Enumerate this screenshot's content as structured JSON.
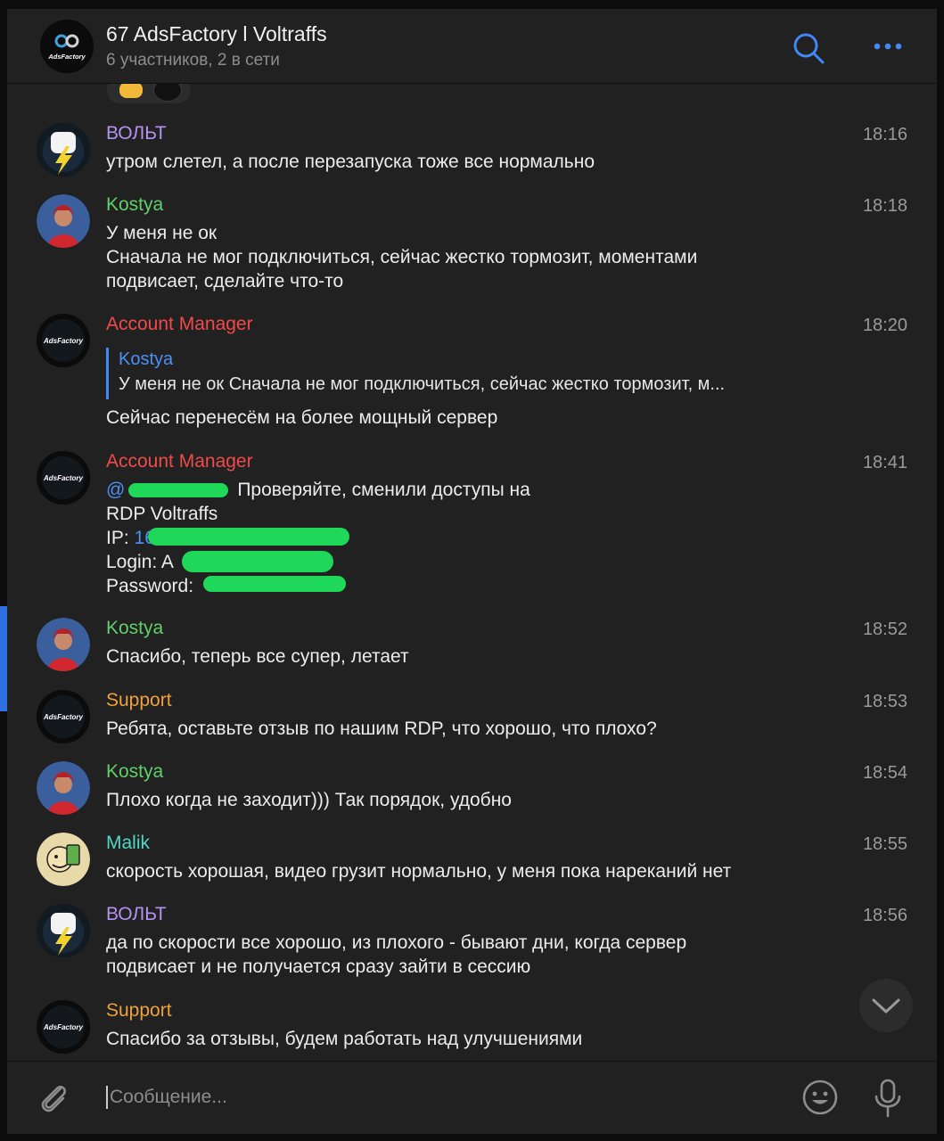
{
  "header": {
    "title": "67 AdsFactory l Voltraffs",
    "subtitle": "6 участников, 2 в сети",
    "avatar_logo_text": "AdsFactory"
  },
  "messages": [
    {
      "sender": "ВОЛЬТ",
      "sender_color": "#b392f0",
      "time": "18:16",
      "avatar": "volt",
      "text": "утром слетел, а после перезапуска тоже все нормально"
    },
    {
      "sender": "Kostya",
      "sender_color": "#5fd06a",
      "time": "18:18",
      "avatar": "kostya",
      "text": "У меня не ок\nСначала не мог подключиться, сейчас жестко тормозит, моментами\nподвисает, сделайте что-то"
    },
    {
      "sender": "Account Manager",
      "sender_color": "#f04a4a",
      "time": "18:20",
      "avatar": "adsfactory",
      "reply_name": "Kostya",
      "reply_text": "У меня не ок Сначала не мог подключиться, сейчас жестко тормозит, м...",
      "text": "Сейчас перенесём на более мощный сервер"
    },
    {
      "sender": "Account Manager",
      "sender_color": "#f04a4a",
      "time": "18:41",
      "avatar": "adsfactory",
      "mention": "@",
      "line1": "Проверяйте, сменили доступы на",
      "line2": "RDP Voltraffs",
      "ip_label": "IP: ",
      "ip_value": "16",
      "login_label": "Login: A",
      "password_label": "Password: "
    },
    {
      "sender": "Kostya",
      "sender_color": "#5fd06a",
      "time": "18:52",
      "avatar": "kostya",
      "text": "Спасибо, теперь все супер, летает"
    },
    {
      "sender": "Support",
      "sender_color": "#f0a13a",
      "time": "18:53",
      "avatar": "adsfactory",
      "text": "Ребята, оставьте отзыв по нашим RDP, что хорошо, что плохо?"
    },
    {
      "sender": "Kostya",
      "sender_color": "#5fd06a",
      "time": "18:54",
      "avatar": "kostya",
      "text": "Плохо когда не заходит))) Так порядок, удобно"
    },
    {
      "sender": "Malik",
      "sender_color": "#4fd8c4",
      "time": "18:55",
      "avatar": "malik",
      "text": "скорость хорошая, видео грузит нормально, у меня пока нареканий нет"
    },
    {
      "sender": "ВОЛЬТ",
      "sender_color": "#b392f0",
      "time": "18:56",
      "avatar": "volt",
      "text": "да по скорости все хорошо, из плохого - бывают дни, когда сервер\nподвисает и не получается сразу зайти в сессию"
    },
    {
      "sender": "Support",
      "sender_color": "#f0a13a",
      "time": "",
      "avatar": "adsfactory",
      "text": "Спасибо за отзывы, будем работать над улучшениями"
    }
  ],
  "composer": {
    "placeholder": "Сообщение..."
  },
  "icons": {
    "search": "search-icon",
    "more": "more-icon",
    "attach": "paperclip-icon",
    "emoji": "emoji-icon",
    "mic": "microphone-icon",
    "scroll_down": "chevron-down-icon"
  },
  "colors": {
    "background": "#212121",
    "accent": "#3f88f5"
  }
}
